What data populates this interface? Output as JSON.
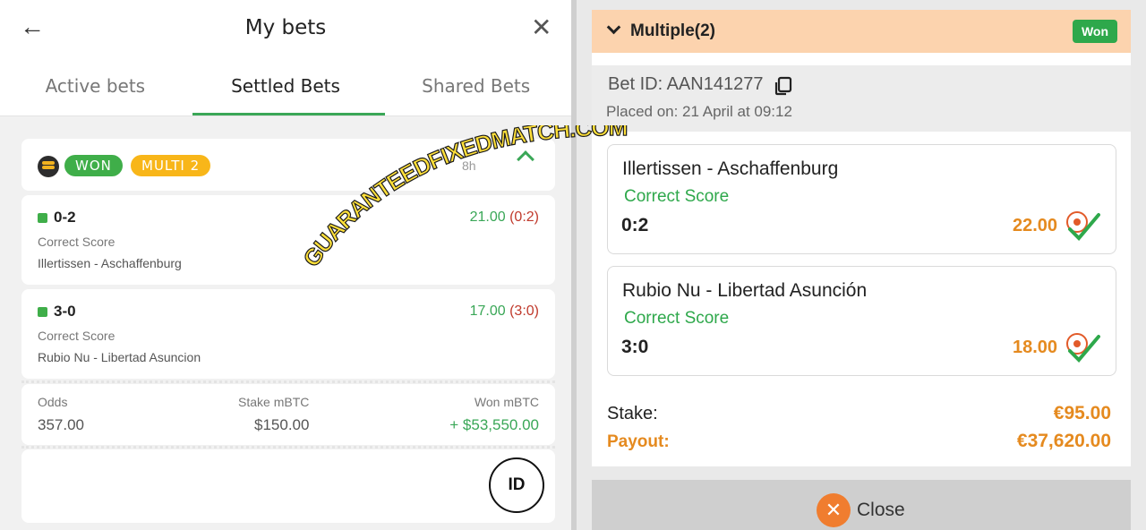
{
  "left": {
    "title": "My bets",
    "back_icon": "←",
    "close_icon": "✕",
    "tabs": [
      {
        "label": "Active bets"
      },
      {
        "label": "Settled Bets"
      },
      {
        "label": "Shared Bets"
      }
    ],
    "bet": {
      "status_badge": "WON",
      "type_badge": "MULTI 2",
      "age": "8h",
      "selections": [
        {
          "score": "0-2",
          "odds": "21.00",
          "result": "(0:2)",
          "market": "Correct Score",
          "event": "Illertissen - Aschaffenburg"
        },
        {
          "score": "3-0",
          "odds": "17.00",
          "result": "(3:0)",
          "market": "Correct Score",
          "event": "Rubio Nu - Libertad Asuncion"
        }
      ],
      "summary": {
        "odds_label": "Odds",
        "odds_value": "357.00",
        "stake_label": "Stake mBTC",
        "stake_value": "$150.00",
        "won_label": "Won mBTC",
        "won_value": "+ $53,550.00"
      }
    },
    "id_button": "ID"
  },
  "right": {
    "header_title": "Multiple(2)",
    "status_tag": "Won",
    "bet_id": "Bet ID: AAN141277",
    "placed_on": "Placed on: 21 April at 09:12",
    "selections": [
      {
        "event": "Illertissen - Aschaffenburg",
        "market": "Correct Score",
        "score": "0:2",
        "odds": "22.00"
      },
      {
        "event": "Rubio Nu - Libertad Asunción",
        "market": "Correct Score",
        "score": "3:0",
        "odds": "18.00"
      }
    ],
    "stake_label": "Stake:",
    "stake_value": "€95.00",
    "payout_label": "Payout:",
    "payout_value": "€37,620.00",
    "close_label": "Close",
    "close_icon": "✕"
  },
  "watermark": "GUARANTEEDFIXEDMATCH.COM",
  "colors": {
    "accent_green": "#3aa757",
    "won_orange": "#e58a1f",
    "header_peach": "#fcd3ae"
  }
}
